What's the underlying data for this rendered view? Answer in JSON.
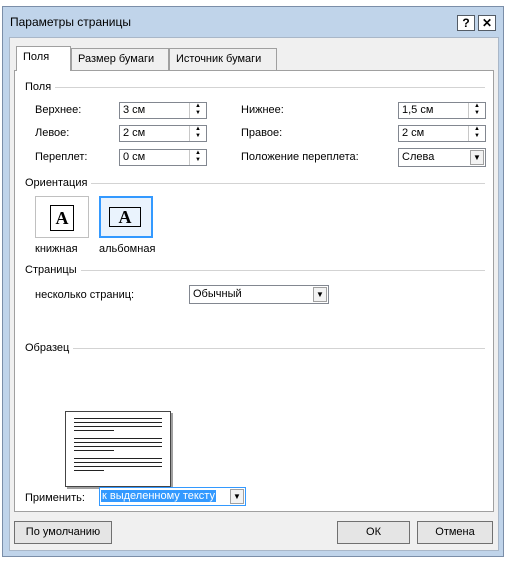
{
  "window": {
    "title": "Параметры страницы",
    "help_glyph": "?",
    "close_glyph": "✕"
  },
  "tabs": [
    {
      "label": "Поля",
      "active": true
    },
    {
      "label": "Размер бумаги",
      "active": false
    },
    {
      "label": "Источник бумаги",
      "active": false
    }
  ],
  "margins": {
    "group_label": "Поля",
    "top": {
      "label": "Верхнее:",
      "value": "3 см"
    },
    "bottom": {
      "label": "Нижнее:",
      "value": "1,5 см"
    },
    "left": {
      "label": "Левое:",
      "value": "2 см"
    },
    "right": {
      "label": "Правое:",
      "value": "2 см"
    },
    "gutter": {
      "label": "Переплет:",
      "value": "0 см"
    },
    "gutter_pos": {
      "label": "Положение переплета:",
      "value": "Слева"
    }
  },
  "orientation": {
    "group_label": "Ориентация",
    "portrait": {
      "label": "книжная",
      "glyph": "A"
    },
    "landscape": {
      "label": "альбомная",
      "glyph": "A",
      "selected": true
    }
  },
  "pages": {
    "group_label": "Страницы",
    "multiple_label": "несколько страниц:",
    "value": "Обычный"
  },
  "sample": {
    "group_label": "Образец"
  },
  "apply": {
    "label": "Применить:",
    "value": "к выделенному тексту"
  },
  "buttons": {
    "default": "По умолчанию",
    "ok": "ОК",
    "cancel": "Отмена"
  },
  "colors": {
    "title_bar": "#c0d4ea",
    "selection": "#3399ff",
    "focus_border": "#3399ff"
  }
}
